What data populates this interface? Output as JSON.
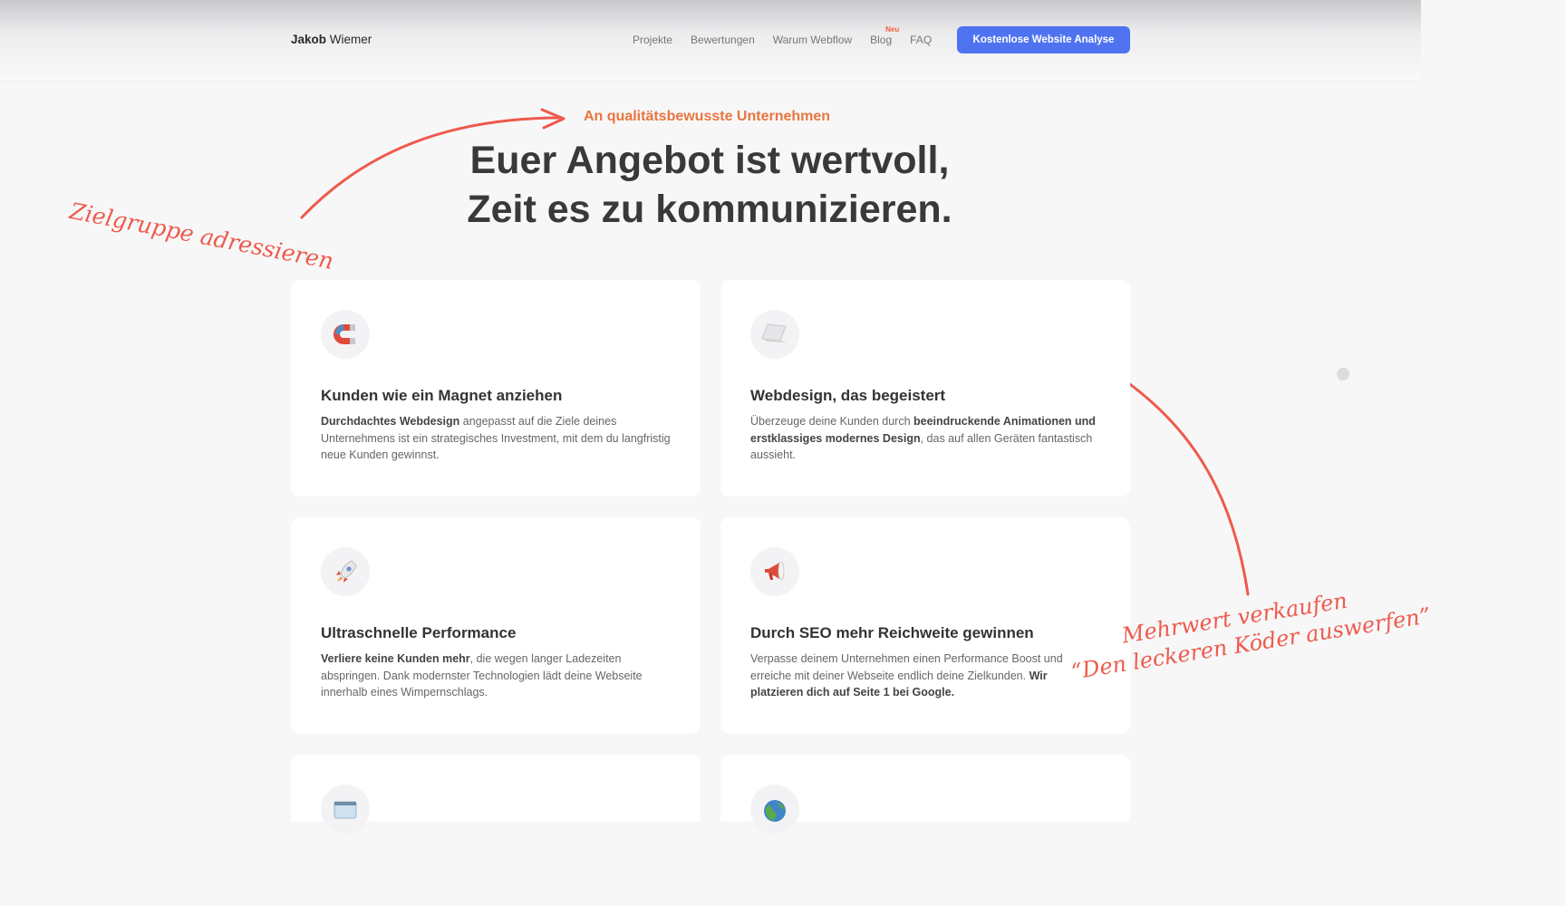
{
  "nav": {
    "brand_first": "Jakob",
    "brand_last": "Wiemer",
    "links": [
      "Projekte",
      "Bewertungen",
      "Warum Webflow",
      "Blog",
      "FAQ"
    ],
    "blog_badge": "Neu",
    "cta": "Kostenlose Website Analyse"
  },
  "hero": {
    "eyebrow": "An qualitätsbewusste Unternehmen",
    "headline_line1": "Euer Angebot ist wertvoll,",
    "headline_line2": "Zeit es zu kommunizieren."
  },
  "annotations": {
    "left": "Zielgruppe adressieren",
    "right_line1": "Mehrwert verkaufen",
    "right_line2": "“Den leckeren Köder auswerfen”"
  },
  "cards": [
    {
      "icon": "magnet-icon",
      "title": "Kunden wie ein Magnet anziehen",
      "body_bold1": "Durchdachtes Webdesign",
      "body_rest": " angepasst auf die Ziele deines Unternehmens ist ein strategisches Investment, mit dem du langfristig neue Kunden gewinnst."
    },
    {
      "icon": "laptop-icon",
      "title": "Webdesign, das begeistert",
      "body_pre": "Überzeuge deine Kunden durch ",
      "body_bold1": "beeindruckende Animationen und erstklassiges modernes Design",
      "body_rest": ", das auf allen Geräten fantastisch aussieht."
    },
    {
      "icon": "rocket-icon",
      "title": "Ultraschnelle Performance",
      "body_bold1": "Verliere keine Kunden mehr",
      "body_rest": ", die wegen langer Ladezeiten abspringen. Dank modernster Technologien  lädt deine Webseite innerhalb eines Wimpernschlags."
    },
    {
      "icon": "megaphone-icon",
      "title": "Durch SEO mehr Reichweite gewinnen",
      "body_pre": "Verpasse deinem Unternehmen einen Performance Boost und erreiche mit deiner Webseite endlich deine Zielkunden. ",
      "body_bold1": "Wir platzieren dich auf Seite 1 bei Google."
    }
  ],
  "icons": {
    "card5": "browser-window-icon",
    "card6": "globe-icon"
  }
}
